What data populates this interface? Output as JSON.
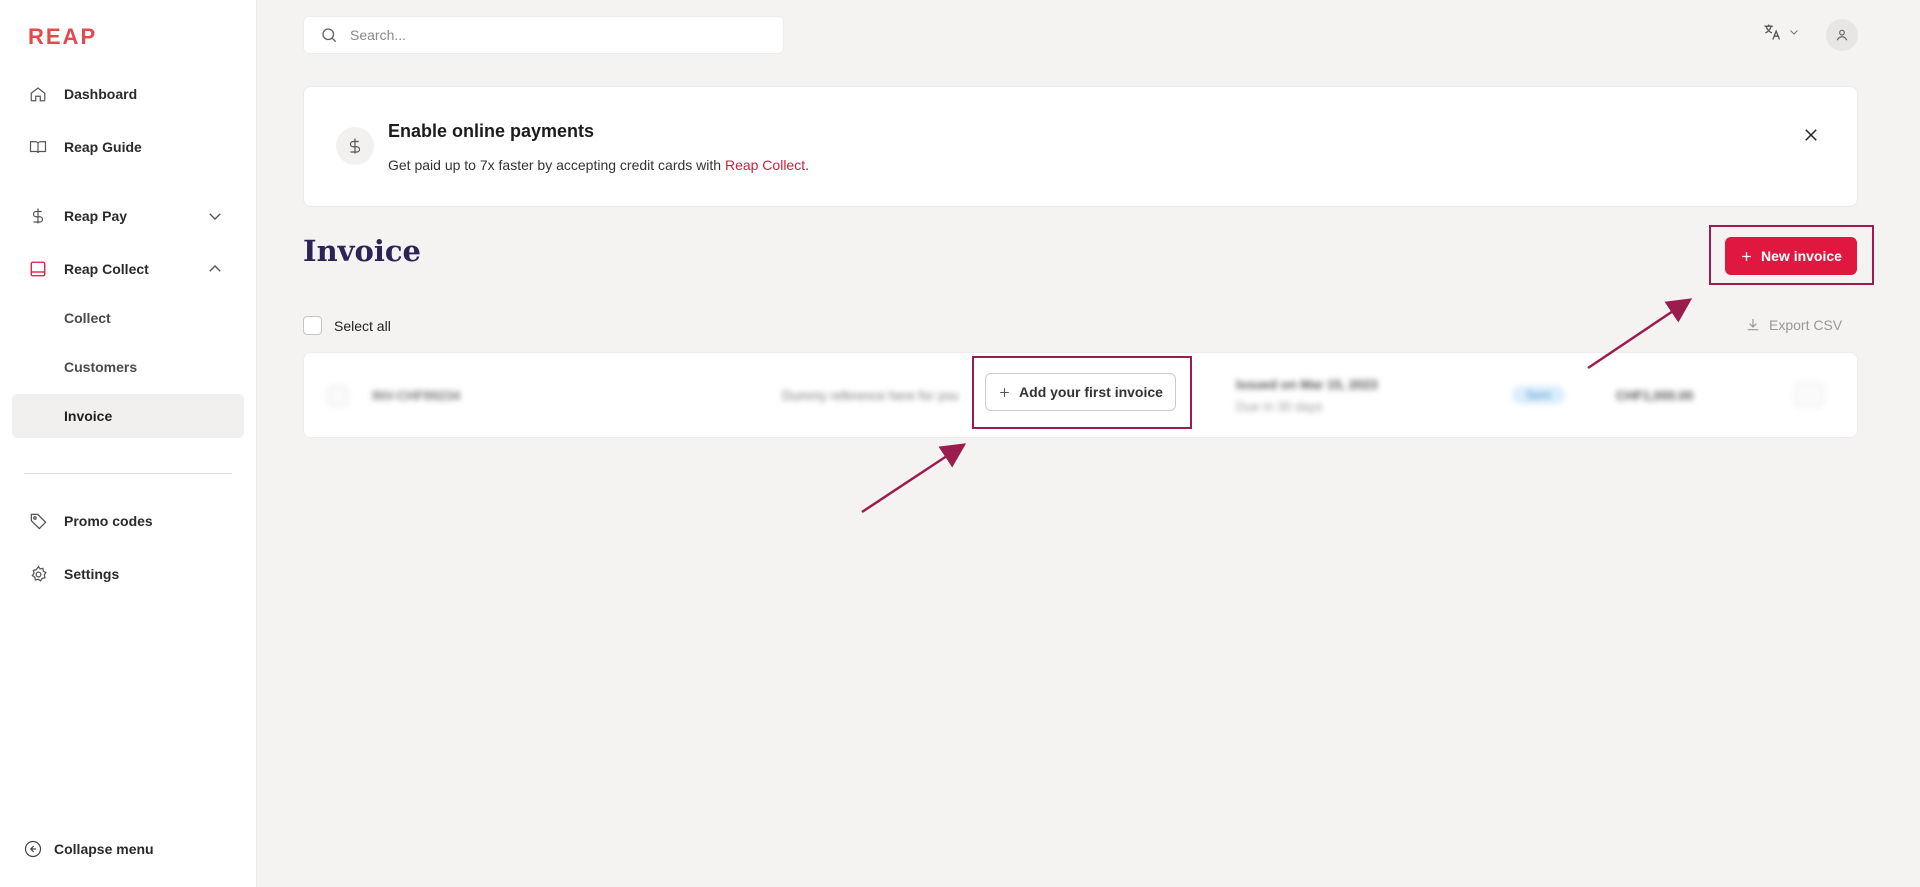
{
  "app": {
    "logo": "REAP"
  },
  "sidebar": {
    "items": [
      {
        "label": "Dashboard",
        "icon": "home-icon"
      },
      {
        "label": "Reap Guide",
        "icon": "book-icon"
      },
      {
        "label": "Reap Pay",
        "icon": "dollar-icon"
      },
      {
        "label": "Reap Collect",
        "icon": "inbox-icon"
      }
    ],
    "sub_items": [
      {
        "label": "Collect"
      },
      {
        "label": "Customers"
      },
      {
        "label": "Invoice"
      }
    ],
    "lower_items": [
      {
        "label": "Promo codes",
        "icon": "tag-icon"
      },
      {
        "label": "Settings",
        "icon": "gear-icon"
      }
    ],
    "collapse_label": "Collapse menu"
  },
  "header": {
    "search_placeholder": "Search..."
  },
  "banner": {
    "title": "Enable online payments",
    "description": "Get paid up to 7x faster by accepting credit cards with ",
    "link": "Reap Collect",
    "suffix": "."
  },
  "main": {
    "title": "Invoice",
    "new_button": "New invoice",
    "select_all": "Select all",
    "export_label": "Export CSV",
    "add_first_label": "Add your first invoice",
    "placeholder_row": {
      "number": "INV-CHF89234",
      "reference": "Dummy reference here for you",
      "due": "Issued on Mar 15, 2023",
      "due_sub": "Due in 30 days",
      "status": "Sent",
      "amount": "CHF1,000.00"
    }
  },
  "colors": {
    "brand": "#e5484d",
    "primary_button": "#e0173f",
    "title": "#2e2355",
    "highlight": "#9b1d4f"
  }
}
